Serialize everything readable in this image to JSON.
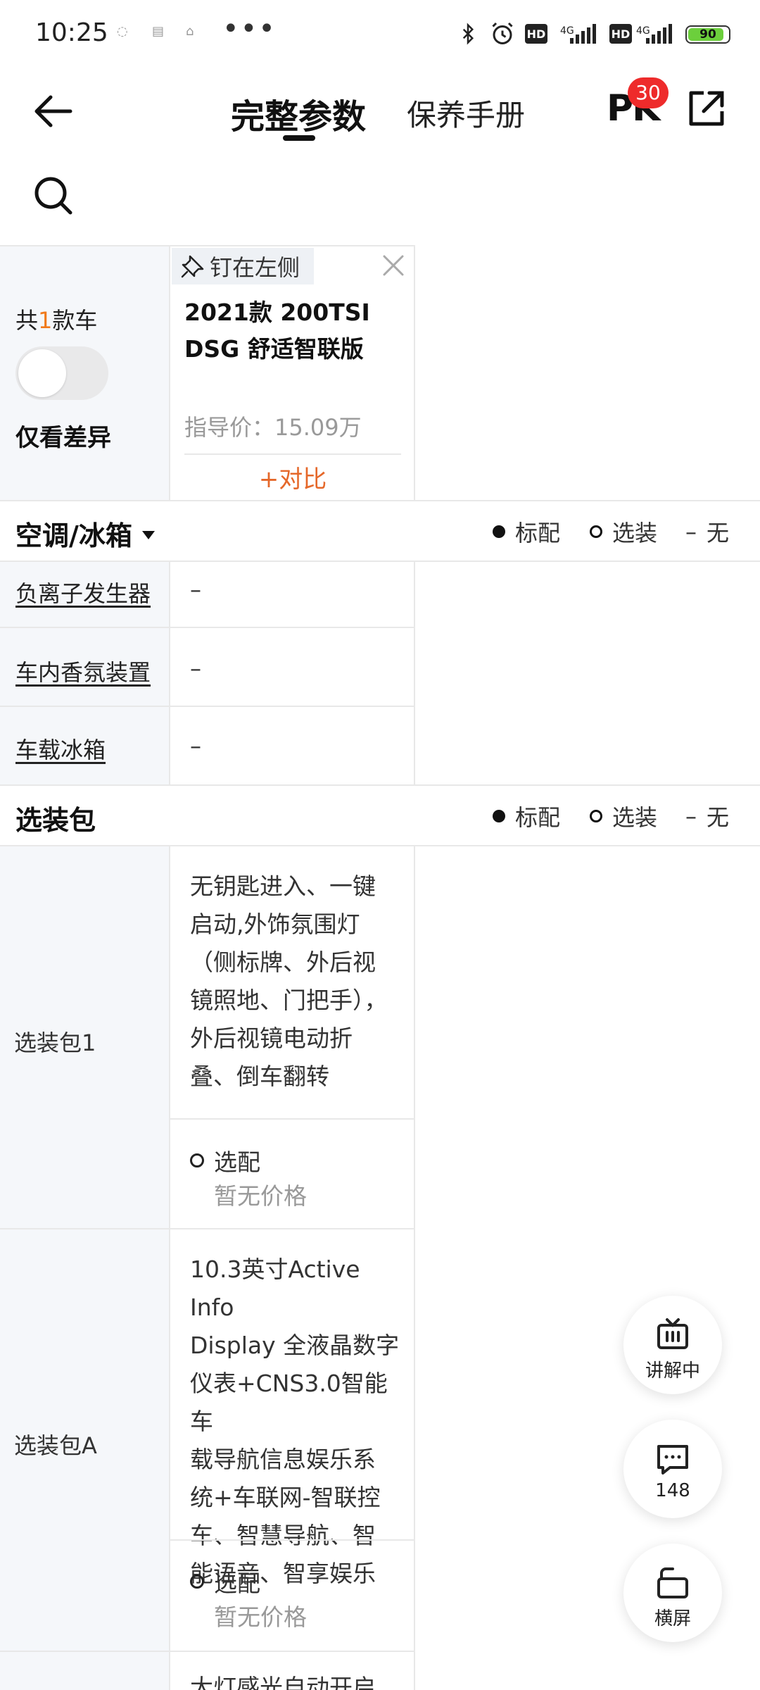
{
  "status_bar": {
    "time": "10:25",
    "more": "•••",
    "hd": "HD",
    "net": "4G",
    "battery": "90",
    "battery_fraction": 0.9
  },
  "nav": {
    "tab_active": "完整参数",
    "tab_2": "保养手册",
    "pk_label": "PK",
    "pk_badge": "30"
  },
  "compare": {
    "count_prefix": "共",
    "count_num": "1",
    "count_suffix": "款车",
    "diff_label": "仅看差异",
    "pin_label": "钉在左侧",
    "car_name": "2021款 200TSI DSG 舒适智联版",
    "price": "指导价：15.09万",
    "compare_button": "+对比"
  },
  "legend": {
    "standard": "标配",
    "optional": "选装",
    "none": "无",
    "dash": "–"
  },
  "sections": {
    "aircon": {
      "title": "空调/冰箱",
      "rows": [
        {
          "label": "负离子发生器",
          "value": "–"
        },
        {
          "label": "车内香氛装置",
          "value": "–"
        },
        {
          "label": "车载冰箱",
          "value": "–"
        }
      ]
    },
    "packages": {
      "title": "选装包",
      "items": [
        {
          "label": "选装包1",
          "desc": [
            "无钥匙进入、一键",
            "启动,外饰氛围灯",
            "（侧标牌、外后视",
            "镜照地、门把手），",
            "外后视镜电动折",
            "叠、倒车翻转"
          ],
          "option": "选配",
          "price": "暂无价格"
        },
        {
          "label": "选装包A",
          "desc": [
            "10.3英寸Active Info",
            "Display 全液晶数字",
            "仪表+CNS3.0智能车",
            "载导航信息娱乐系",
            "统+车联网-智联控",
            "车、智慧导航、智",
            "能语音、智享娱乐"
          ],
          "option": "选配",
          "price": "暂无价格"
        }
      ],
      "partial_next": "大灯感光自动开启"
    }
  },
  "floating": {
    "live": "讲解中",
    "comments": "148",
    "landscape": "横屏"
  }
}
